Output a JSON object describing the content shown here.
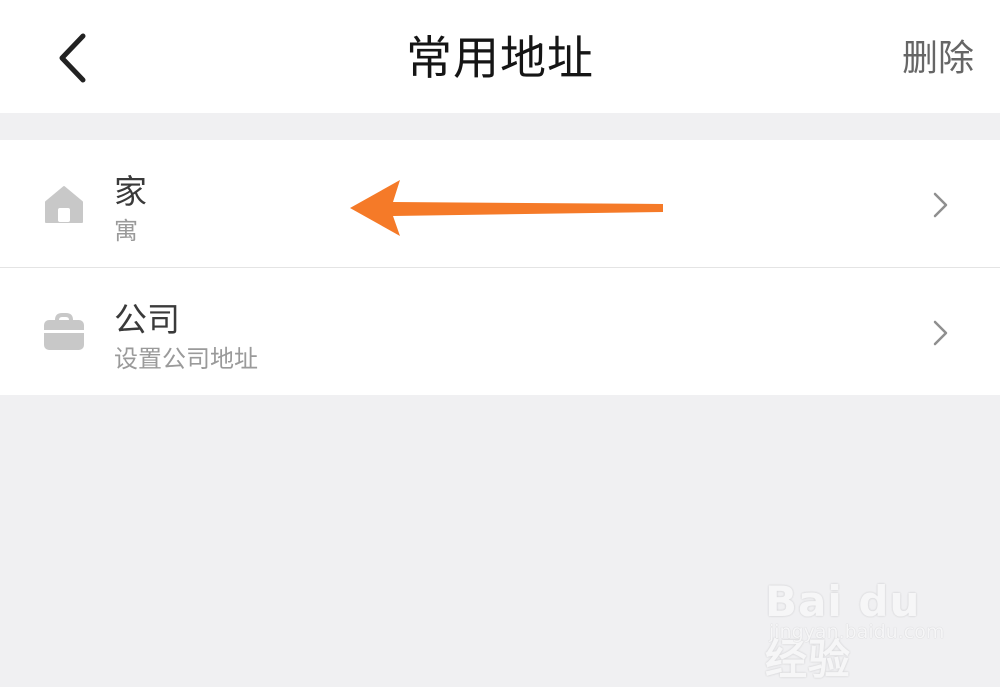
{
  "header": {
    "title": "常用地址",
    "delete_label": "删除",
    "back_icon": "chevron-left-icon"
  },
  "addresses": [
    {
      "icon": "home-icon",
      "title": "家",
      "subtitle": "寓",
      "chevron": "chevron-right-icon"
    },
    {
      "icon": "briefcase-icon",
      "title": "公司",
      "subtitle": "设置公司地址",
      "chevron": "chevron-right-icon"
    }
  ],
  "annotation": {
    "color": "#f57a28"
  },
  "watermark": {
    "brand": "Bai du 经验",
    "url": "jingyan.baidu.com"
  },
  "colors": {
    "background": "#f0f0f2",
    "surface": "#ffffff",
    "icon_gray": "#c8c8c8"
  }
}
